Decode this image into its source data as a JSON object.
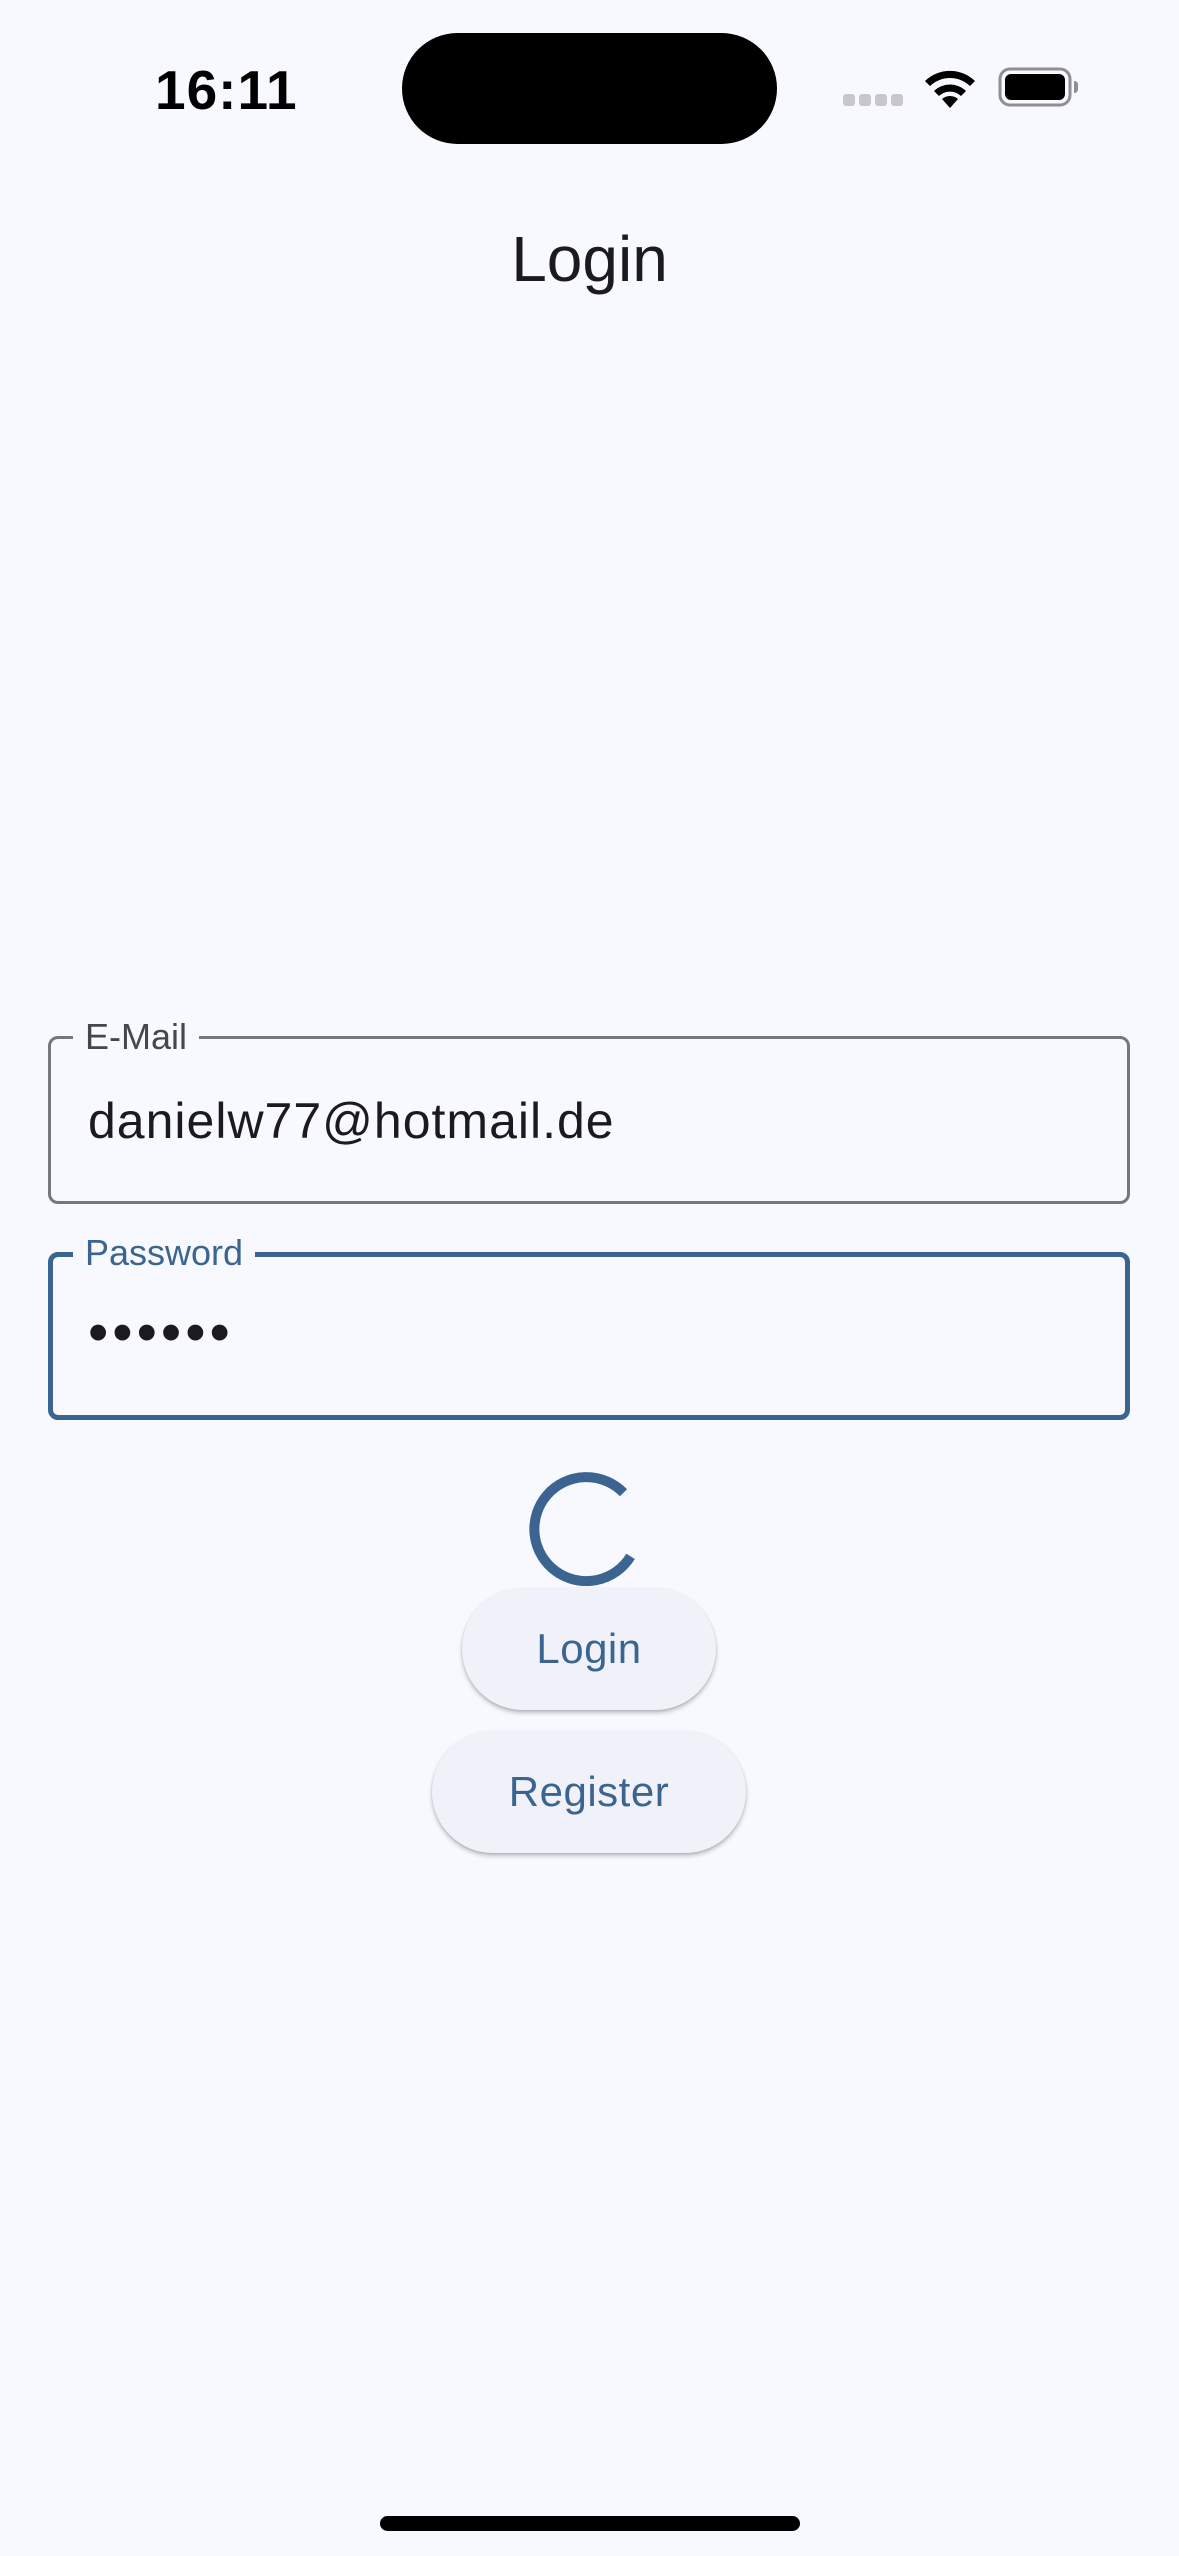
{
  "status_bar": {
    "time": "16:11",
    "icons": [
      "cell-signal-icon",
      "wifi-icon",
      "battery-icon"
    ]
  },
  "app_bar": {
    "title": "Login"
  },
  "form": {
    "email": {
      "label": "E-Mail",
      "value": "danielw77@hotmail.de"
    },
    "password": {
      "label": "Password",
      "value": "••••••"
    }
  },
  "buttons": {
    "login_label": "Login",
    "register_label": "Register"
  },
  "colors": {
    "primary": "#3b6590",
    "background": "#f8f9fe",
    "outline": "#74777f",
    "button_surface": "#f1f2f9"
  },
  "state": {
    "loading_indicator": "spinner"
  }
}
